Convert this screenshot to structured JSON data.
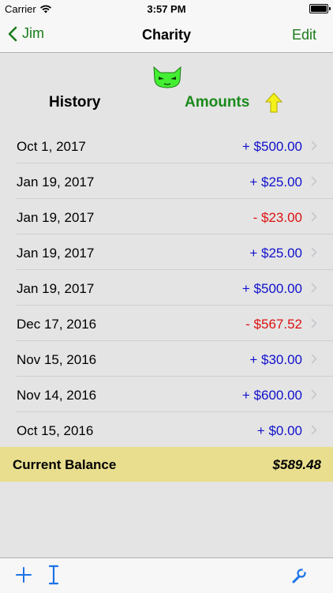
{
  "status_bar": {
    "carrier": "Carrier",
    "time": "3:57 PM",
    "battery_level": 1.0
  },
  "nav": {
    "back_label": "Jim",
    "title": "Charity",
    "edit_label": "Edit"
  },
  "header": {
    "history_label": "History",
    "amounts_label": "Amounts",
    "sort_indicator_icon": "arrow-up-icon",
    "mascot_icon": "green-cat-icon"
  },
  "transactions": [
    {
      "date": "Oct 1, 2017",
      "amount": "+ $500.00",
      "type": "credit"
    },
    {
      "date": "Jan 19, 2017",
      "amount": "+ $25.00",
      "type": "credit"
    },
    {
      "date": "Jan 19, 2017",
      "amount": "- $23.00",
      "type": "debit"
    },
    {
      "date": "Jan 19, 2017",
      "amount": "+ $25.00",
      "type": "credit"
    },
    {
      "date": "Jan 19, 2017",
      "amount": "+ $500.00",
      "type": "credit"
    },
    {
      "date": "Dec 17, 2016",
      "amount": "- $567.52",
      "type": "debit"
    },
    {
      "date": "Nov 15, 2016",
      "amount": "+ $30.00",
      "type": "credit"
    },
    {
      "date": "Nov 14, 2016",
      "amount": "+ $600.00",
      "type": "credit"
    },
    {
      "date": "Oct 15, 2016",
      "amount": "+ $0.00",
      "type": "credit"
    }
  ],
  "balance": {
    "label": "Current Balance",
    "value": "$589.48"
  },
  "toolbar": {
    "add_icon": "plus-icon",
    "cursor_icon": "text-cursor-icon",
    "settings_icon": "wrench-icon"
  },
  "colors": {
    "tint": "#1b7b1b",
    "amounts_header": "#1b8a1b",
    "credit": "#1010cc",
    "debit": "#dd1111",
    "balance_bg": "#e8de8e",
    "toolbar_blue": "#1a73e8"
  }
}
